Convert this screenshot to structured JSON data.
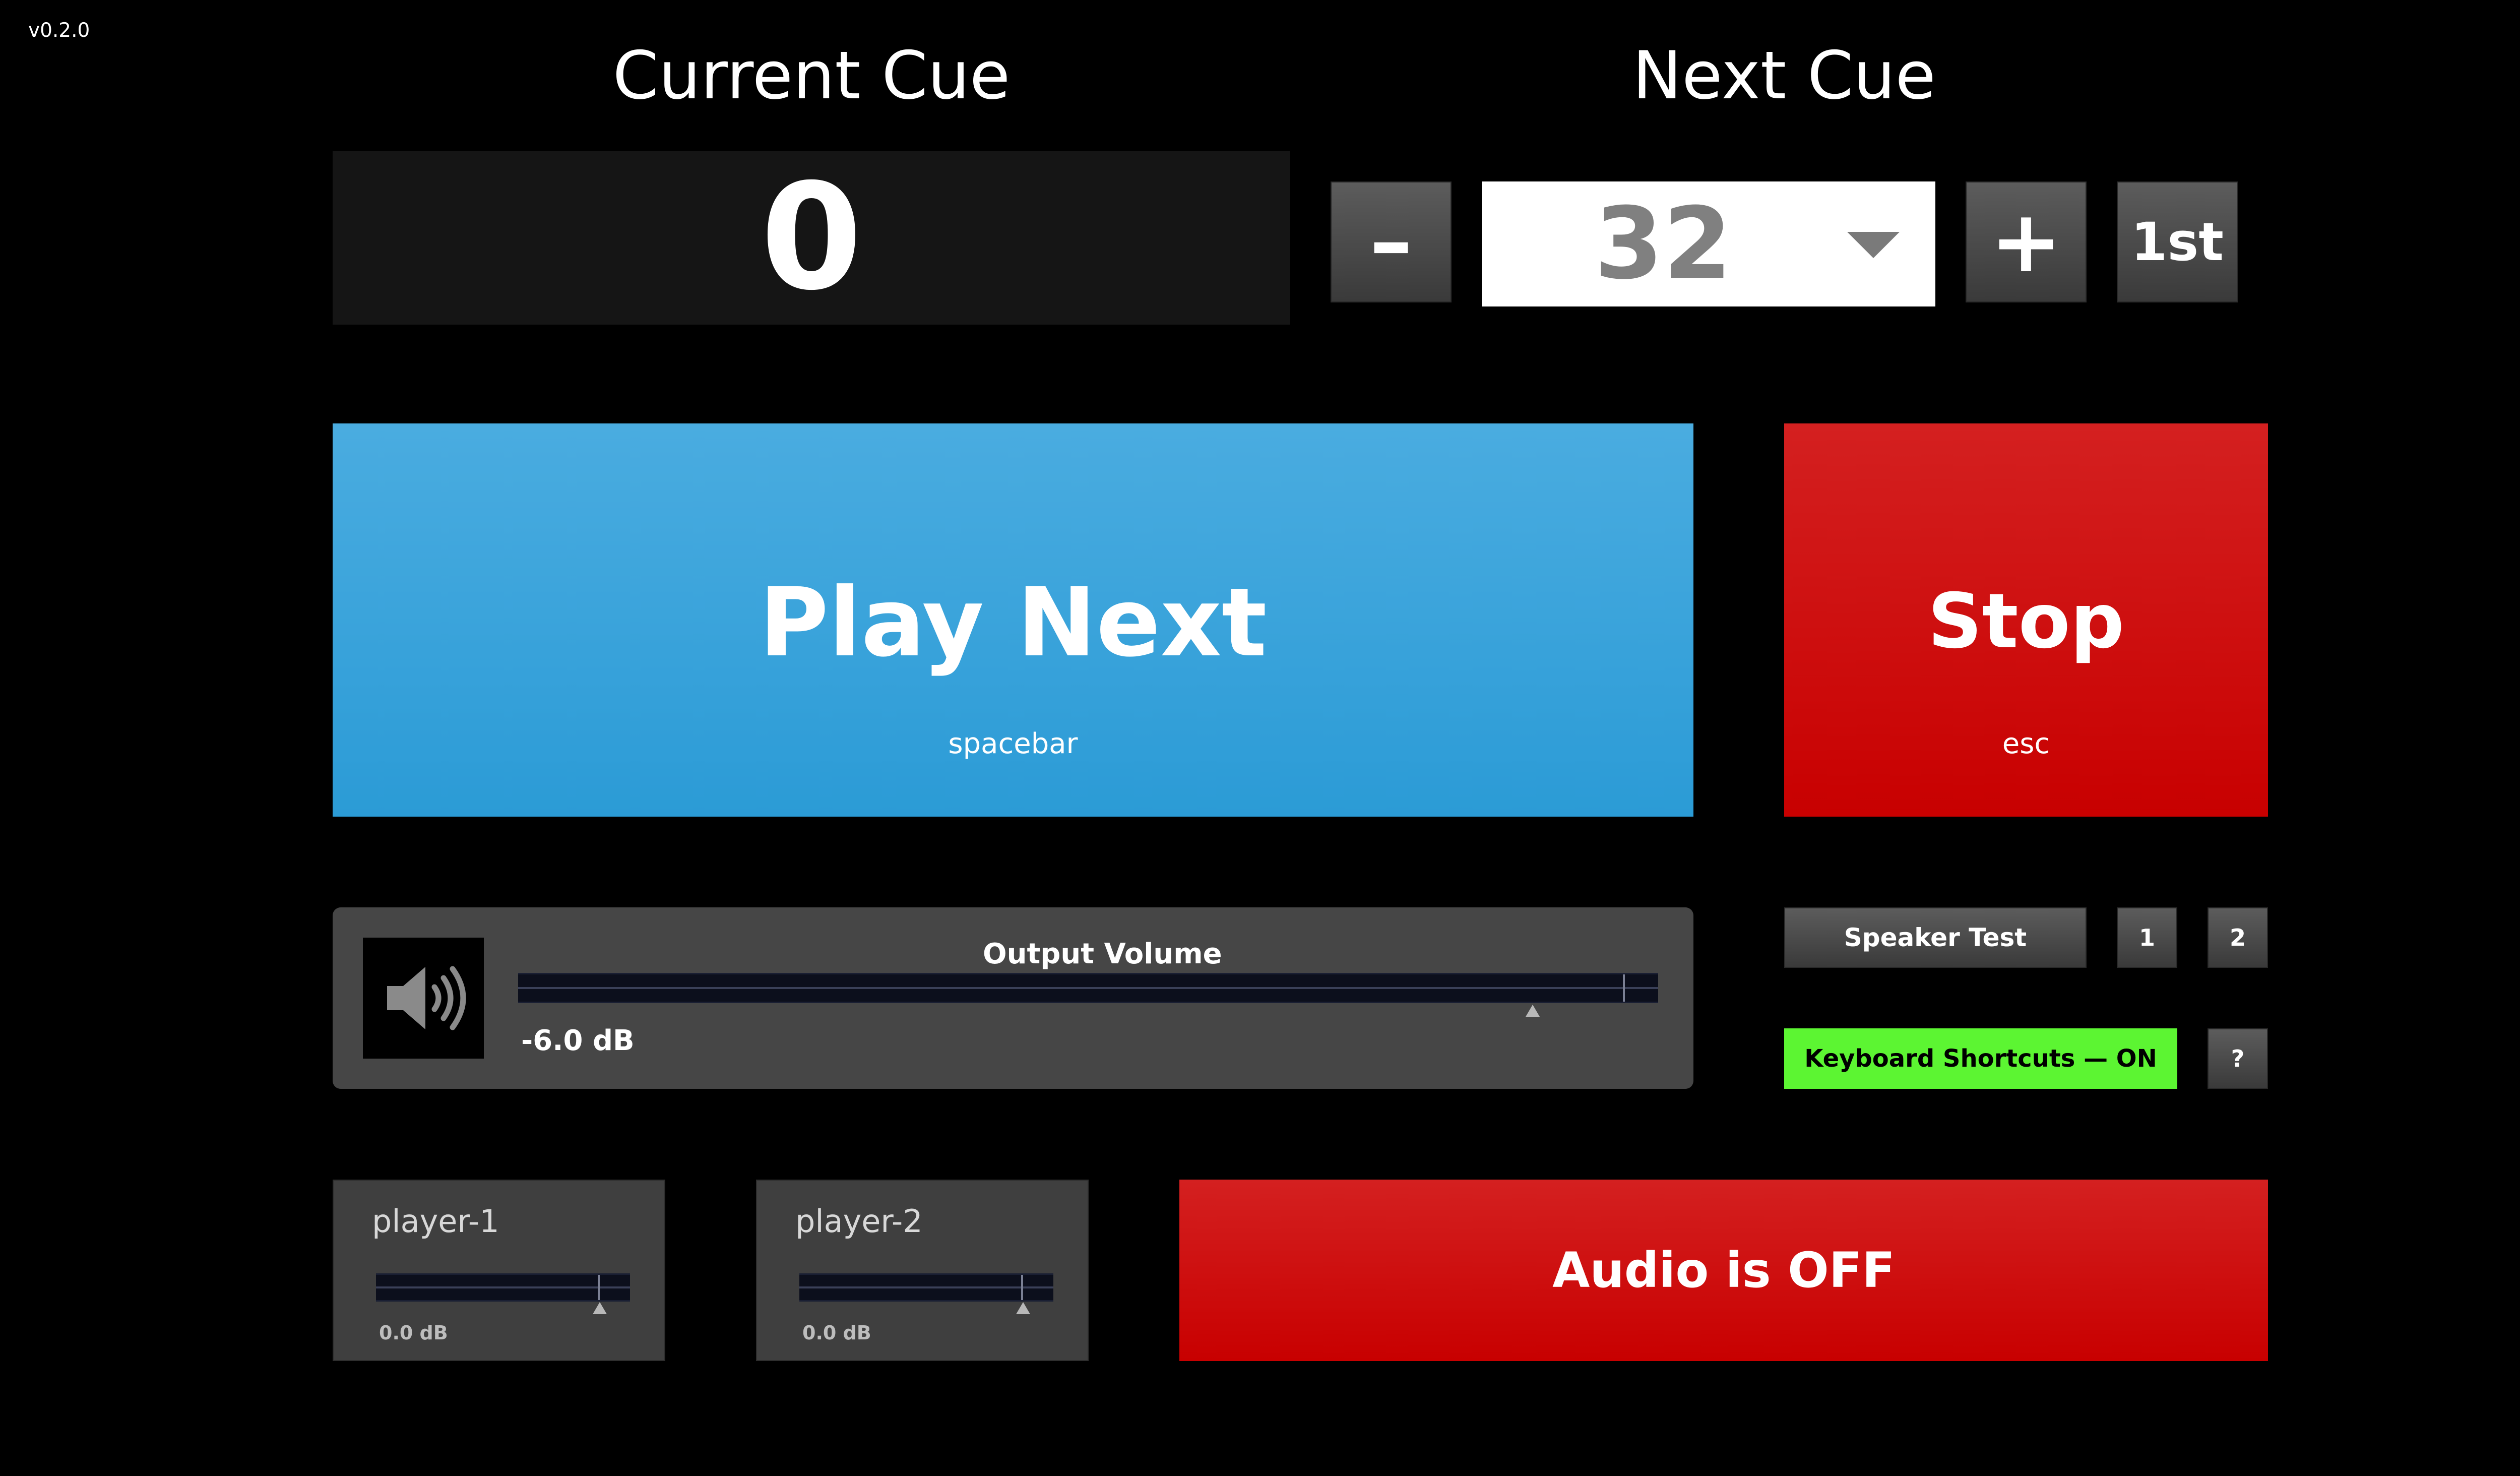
{
  "app": {
    "version": "v0.2.0"
  },
  "current_cue": {
    "title": "Current Cue",
    "value": "0"
  },
  "next_cue": {
    "title": "Next Cue",
    "selected": "32",
    "decrement_label": "–",
    "increment_label": "+",
    "first_label": "1st"
  },
  "play": {
    "label": "Play Next",
    "shortcut": "spacebar"
  },
  "stop": {
    "label": "Stop",
    "shortcut": "esc"
  },
  "output_volume": {
    "title": "Output Volume",
    "value_text": "-6.0 dB",
    "level_fraction": 0.89
  },
  "speaker_test": {
    "label": "Speaker Test",
    "channels": [
      "1",
      "2"
    ]
  },
  "keyboard_shortcuts": {
    "label": "Keyboard Shortcuts — ON",
    "help_label": "?"
  },
  "players": [
    {
      "name": "player-1",
      "db": "0.0 dB",
      "level_fraction": 0.88
    },
    {
      "name": "player-2",
      "db": "0.0 dB",
      "level_fraction": 0.88
    }
  ],
  "audio_status": {
    "label": "Audio is OFF"
  },
  "colors": {
    "play_blue": "#3aa3dc",
    "stop_red": "#cc0000",
    "shortcuts_green": "#5cf532",
    "panel_gray": "#464646"
  },
  "icons": {
    "volume": "speaker-volume-icon",
    "dropdown": "chevron-down-icon"
  }
}
